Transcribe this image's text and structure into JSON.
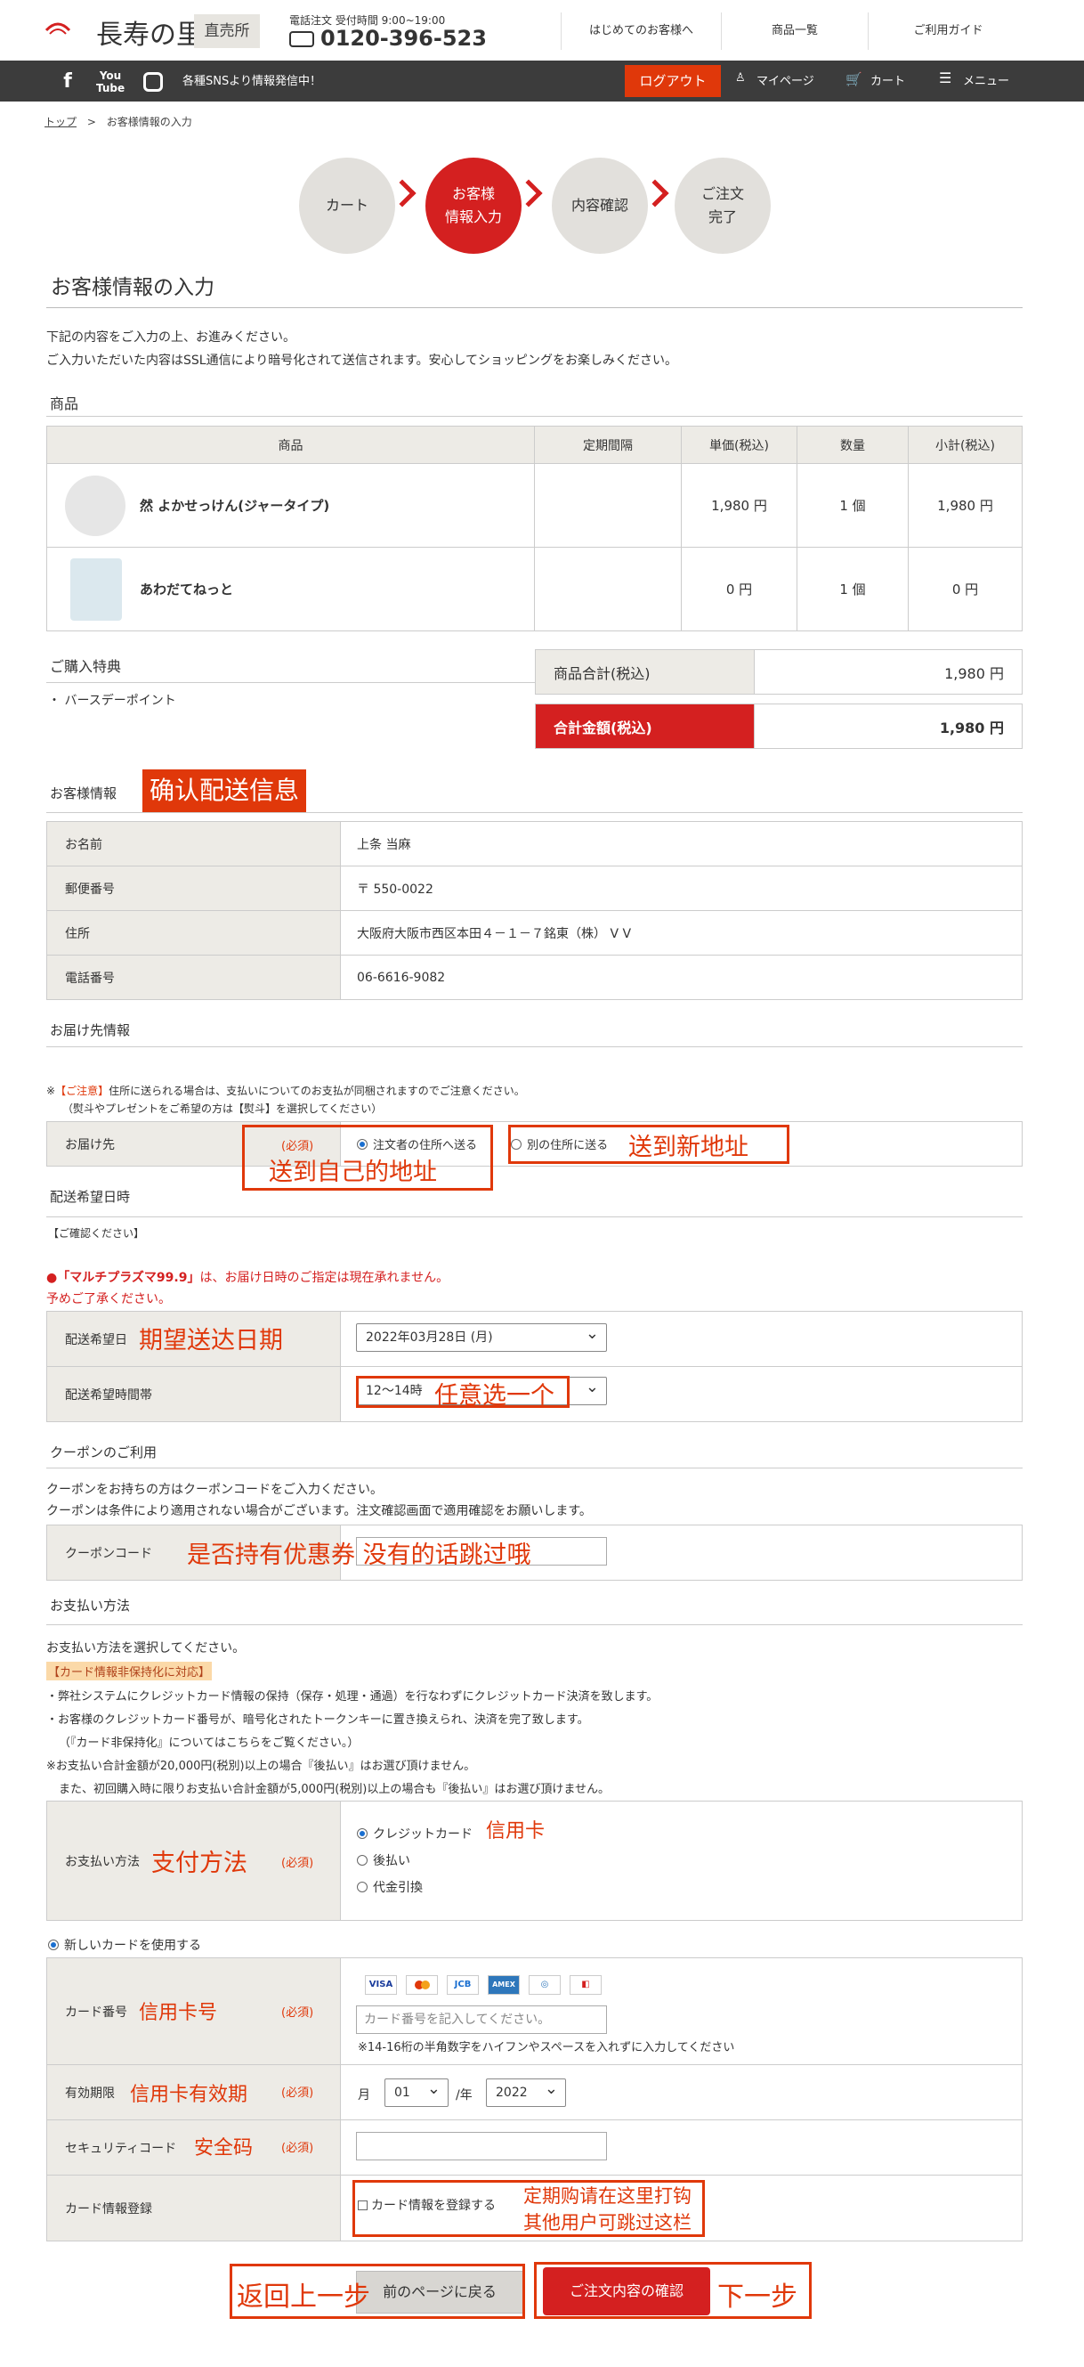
{
  "header": {
    "logo_text": "長寿の里",
    "shop_badge": "直売所",
    "tel_label": "電話注文  受付時間 9:00~19:00",
    "tel_number": "0120-396-523",
    "nav": [
      "はじめてのお客様へ",
      "商品一覧",
      "ご利用ガイド"
    ]
  },
  "topbar": {
    "sns_text": "各種SNSより情報発信中！",
    "logout": "ログアウト",
    "mypage": "マイページ",
    "cart": "カート",
    "menu": "メニュー"
  },
  "breadcrumb": {
    "home": "トップ",
    "sep": ">",
    "current": "お客様情報の入力"
  },
  "steps": {
    "s1": "カート",
    "s2a": "お客様",
    "s2b": "情報入力",
    "s3": "内容確認",
    "s4a": "ご注文",
    "s4b": "完了"
  },
  "page_title": "お客様情報の入力",
  "intro": [
    "下記の内容をご入力の上、お進みください。",
    "ご入力いただいた内容はSSL通信により暗号化されて送信されます。安心してショッピングをお楽しみください。"
  ],
  "products": {
    "section": "商品",
    "headers": [
      "商品",
      "定期間隔",
      "単価(税込)",
      "数量",
      "小計(税込)"
    ],
    "rows": [
      {
        "name": "然 よかせっけん(ジャータイプ)",
        "interval": "",
        "price": "1,980 円",
        "qty": "1 個",
        "subtotal": "1,980 円"
      },
      {
        "name": "あわだてねっと",
        "interval": "",
        "price": "0 円",
        "qty": "1 個",
        "subtotal": "0 円"
      }
    ]
  },
  "benefits": {
    "title": "ご購入特典",
    "item": "・ バースデーポイント"
  },
  "summary": {
    "subtotal_label": "商品合計(税込)",
    "subtotal": "1,980 円",
    "total_label": "合計金額(税込)",
    "total": "1,980 円"
  },
  "customer": {
    "section": "お客様情報",
    "rows": [
      {
        "label": "お名前",
        "value": "上条 当麻"
      },
      {
        "label": "郵便番号",
        "value": "〒  550-0022"
      },
      {
        "label": "住所",
        "value": "大阪府大阪市西区本田４－１－７銘東（株）  V        V"
      },
      {
        "label": "電話番号",
        "value": "06-6616-9082"
      }
    ]
  },
  "delivery": {
    "section": "お届け先情報",
    "notice_mark": "※",
    "notice_head": "【ご注意】",
    "notice_body": "住所に送られる場合は、支払いについてのお支払が同梱されますのでご注意ください。",
    "notice_sub": "（熨斗やプレゼントをご希望の方は【熨斗】を選択してください）",
    "label": "お届け先",
    "required": "(必須)",
    "opt_self": "注文者の住所へ送る",
    "opt_other": "別の住所に送る"
  },
  "schedule": {
    "section": "配送希望日時",
    "confirm": "【ご確認ください】",
    "warn1_a": "●「マルチプラズマ99.9」",
    "warn1_b": "は、お届け日時のご指定は現在承れません。",
    "warn2": "予めご了承ください。",
    "date_label": "配送希望日",
    "date_value": "2022年03月28日 (月)",
    "time_label": "配送希望時間帯",
    "time_value": "12～14時"
  },
  "coupon": {
    "section": "クーポンのご利用",
    "desc1": "クーポンをお持ちの方はクーポンコードをご入力ください。",
    "desc2": "クーポンは条件により適用されない場合がございます。注文確認画面で適用確認をお願いします。",
    "label": "クーポンコード"
  },
  "payment": {
    "section": "お支払い方法",
    "desc": "お支払い方法を選択してください。",
    "badge": "【カード情報非保持化に対応】",
    "lines": [
      "・弊社システムにクレジットカード情報の保持（保存・処理・通過）を行なわずにクレジットカード決済を致します。",
      "・お客様のクレジットカード番号が、暗号化されたトークンキーに置き換えられ、決済を完了致します。",
      "（『カード非保持化』についてはこちらをご覧ください。）",
      "※お支払い合計金額が20,000円(税別)以上の場合『後払い』はお選び頂けません。",
      "また、初回購入時に限りお支払い合計金額が5,000円(税別)以上の場合も『後払い』はお選び頂けません。"
    ],
    "label": "お支払い方法",
    "required": "(必須)",
    "options": [
      "クレジットカード",
      "後払い",
      "代金引換"
    ]
  },
  "card": {
    "new_card": "新しいカードを使用する",
    "number_label": "カード番号",
    "number_placeholder": "カード番号を記入してください。",
    "number_note": "※14-16桁の半角数字をハイフンやスペースを入れずに入力してください",
    "expiry_label": "有効期限",
    "month_prefix": "月",
    "month": "01",
    "year_sep": "/年",
    "year": "2022",
    "cvc_label": "セキュリティコード",
    "register_label": "カード情報登録",
    "register_option": "カード情報を登録する",
    "required": "(必須)",
    "brands": [
      "VISA",
      "MC",
      "JCB",
      "AMEX",
      "DC",
      "DN"
    ]
  },
  "buttons": {
    "back": "前のページに戻る",
    "next": "ご注文内容の確認"
  },
  "annotations": {
    "confirm_shipping": "确认配送信息",
    "to_self": "送到自己的地址",
    "to_new": "送到新地址",
    "expected_date": "期望送达日期",
    "pick_any": "任意选一个",
    "coupon_hint": "是否持有优惠券 没有的话跳过哦",
    "pay_method": "支付方法",
    "credit_card": "信用卡",
    "card_number": "信用卡号",
    "card_expiry": "信用卡有效期",
    "security_code": "安全码",
    "periodic_a": "定期购请在这里打钩",
    "periodic_b": "其他用户可跳过这栏",
    "back": "返回上一步",
    "next": "下一步"
  },
  "colors": {
    "accent": "#d42020",
    "annotation": "#e0380a",
    "bar": "#3c3c3c"
  }
}
